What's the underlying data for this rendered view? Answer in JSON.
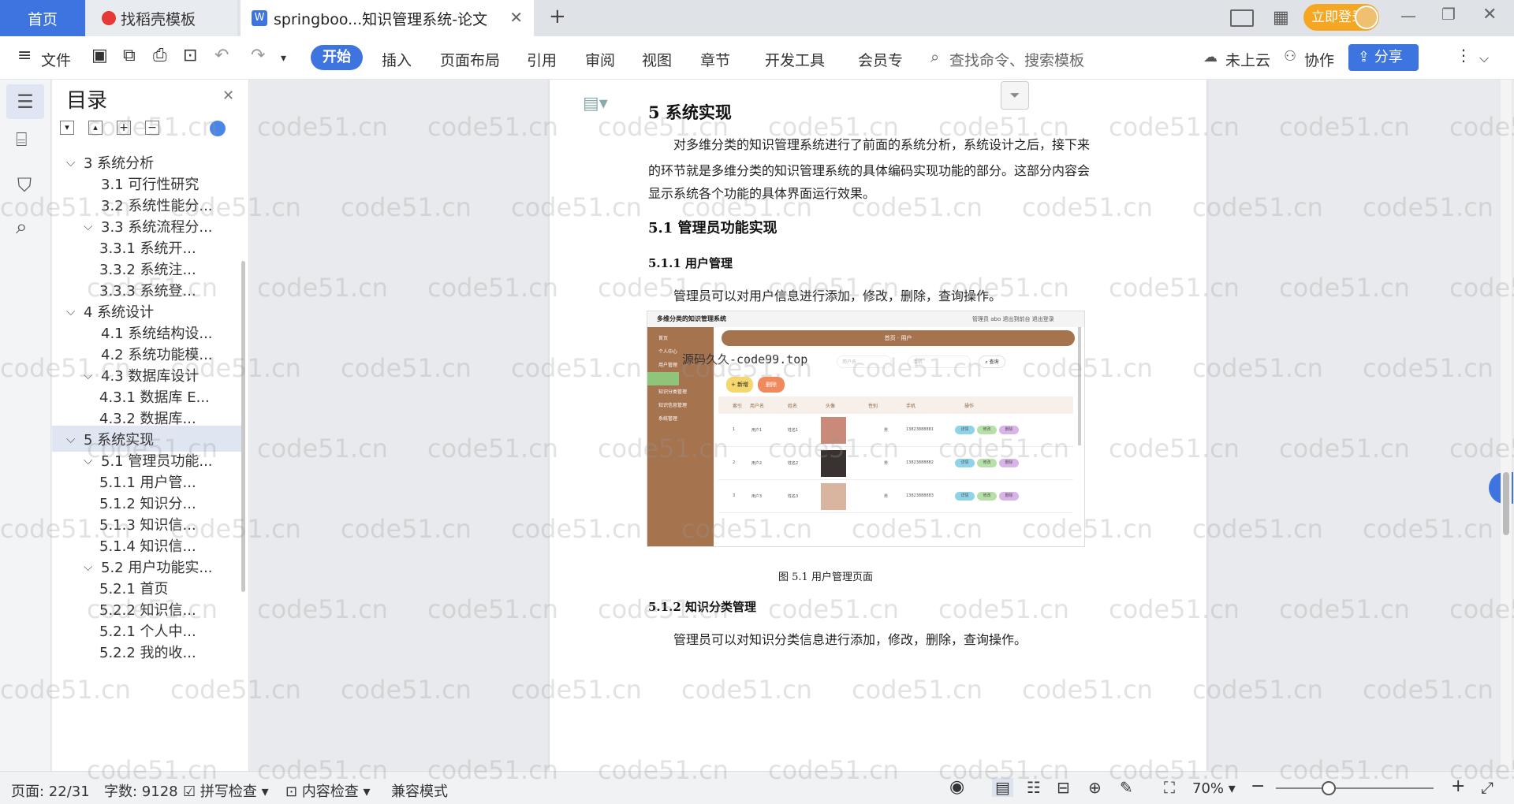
{
  "tabs": {
    "home": "首页",
    "template": "找稻壳模板",
    "doc": "springboo...知识管理系统-论文"
  },
  "titlebar": {
    "login": "立即登录"
  },
  "ribbon": {
    "file": "文件",
    "items": [
      "开始",
      "插入",
      "页面布局",
      "引用",
      "审阅",
      "视图",
      "章节",
      "开发工具",
      "会员专"
    ],
    "search": "查找命令、搜索模板",
    "cloud": "未上云",
    "collab": "协作",
    "share": "分享"
  },
  "toc": {
    "title": "目录",
    "items": [
      {
        "label": "3  系统分析",
        "level": 0
      },
      {
        "label": "3.1 可行性研究",
        "level": 1
      },
      {
        "label": "3.2 系统性能分...",
        "level": 1
      },
      {
        "label": "3.3  系统流程分...",
        "level": 1
      },
      {
        "label": "3.3.1  系统开...",
        "level": 2
      },
      {
        "label": "3.3.2  系统注...",
        "level": 2
      },
      {
        "label": "3.3.3  系统登...",
        "level": 2
      },
      {
        "label": "4  系统设计",
        "level": 0
      },
      {
        "label": "4.1  系统结构设...",
        "level": 1
      },
      {
        "label": "4.2 系统功能模...",
        "level": 1
      },
      {
        "label": "4.3 数据库设计",
        "level": 1
      },
      {
        "label": "4.3.1 数据库 E...",
        "level": 2
      },
      {
        "label": "4.3.2  数据库...",
        "level": 2
      },
      {
        "label": "5  系统实现",
        "level": 0
      },
      {
        "label": "5.1  管理员功能...",
        "level": 1
      },
      {
        "label": "5.1.1  用户管...",
        "level": 2
      },
      {
        "label": "5.1.2  知识分...",
        "level": 2
      },
      {
        "label": "5.1.3  知识信...",
        "level": 2
      },
      {
        "label": "5.1.4  知识信...",
        "level": 2
      },
      {
        "label": "5.2  用户功能实...",
        "level": 1
      },
      {
        "label": "5.2.1  首页",
        "level": 2
      },
      {
        "label": "5.2.2  知识信...",
        "level": 2
      },
      {
        "label": "5.2.1  个人中...",
        "level": 2
      },
      {
        "label": "5.2.2  我的收...",
        "level": 2
      }
    ]
  },
  "doc": {
    "h1": "5  系统实现",
    "p1a": "对多维分类的知识管理系统进行了前面的系统分析，系统设计之后，接下来",
    "p1b": "的环节就是多维分类的知识管理系统的具体编码实现功能的部分。这部分内容会",
    "p1c": "显示系统各个功能的具体界面运行效果。",
    "h2": "5.1  管理员功能实现",
    "h3a": "5.1.1  用户管理",
    "p2": "管理员可以对用户信息进行添加，修改，删除，查询操作。",
    "caption": "图 5.1  用户管理页面",
    "h3b": "5.1.2  知识分类管理",
    "p3": "管理员可以对知识分类信息进行添加，修改，删除，查询操作。",
    "overlay": "源码久久-code99.top"
  },
  "screenshot": {
    "title": "多维分类的知识管理系统",
    "topright": "管理员 abo    退出到前台    退出登录",
    "banner": "首页  ·  用户",
    "menu": [
      "首页",
      "个人中心",
      "用户管理",
      "",
      "知识分类管理",
      "知识信息管理",
      "系统管理"
    ],
    "search": [
      "用户名",
      "手机"
    ],
    "btns": [
      "+ 新增",
      "删除"
    ],
    "cols": [
      "索引",
      "用户名",
      "姓名",
      "头像",
      "性别",
      "手机",
      "操作"
    ],
    "rows": [
      [
        "1",
        "用户1",
        "姓名1",
        "男",
        "13823888881"
      ],
      [
        "2",
        "用户2",
        "姓名2",
        "男",
        "13823888882"
      ],
      [
        "3",
        "用户3",
        "姓名3",
        "男",
        "13823888883"
      ]
    ],
    "ops": [
      "详情",
      "修改",
      "删除"
    ]
  },
  "status": {
    "page": "页面: 22/31",
    "words": "字数: 9128",
    "spell": "拼写检查",
    "content": "内容检查",
    "compat": "兼容模式",
    "zoom": "70%"
  },
  "watermark": "code51.cn",
  "colors": {
    "accent": "#3d74e0",
    "menuBrown": "#a6734f",
    "login": "#f5a623"
  }
}
